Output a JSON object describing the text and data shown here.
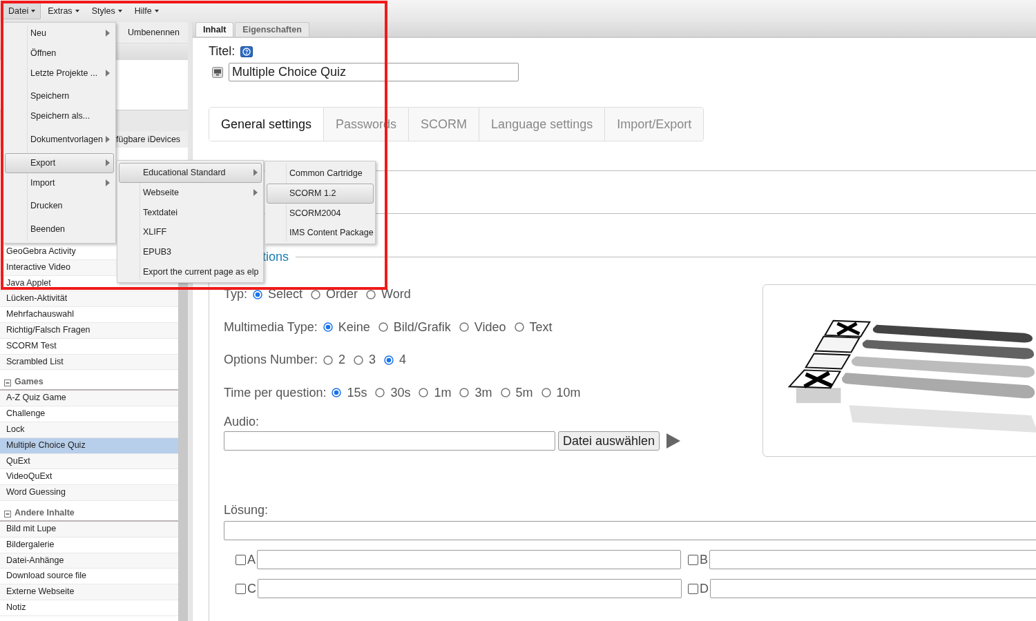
{
  "menubar": [
    {
      "label": "Datei",
      "selected": true
    },
    {
      "label": "Extras",
      "selected": false
    },
    {
      "label": "Styles",
      "selected": false
    },
    {
      "label": "Hilfe",
      "selected": false
    }
  ],
  "file_menu": [
    {
      "kind": "item",
      "label": "Neu",
      "submenu": true,
      "selected": false
    },
    {
      "kind": "item",
      "label": "Öffnen",
      "submenu": false,
      "selected": false
    },
    {
      "kind": "item",
      "label": "Letzte Projekte ...",
      "submenu": true,
      "selected": false
    },
    {
      "kind": "separator"
    },
    {
      "kind": "item",
      "label": "Speichern",
      "submenu": false,
      "selected": false
    },
    {
      "kind": "item",
      "label": "Speichern als...",
      "submenu": false,
      "selected": false
    },
    {
      "kind": "separator"
    },
    {
      "kind": "item",
      "label": "Dokumentvorlagen",
      "submenu": true,
      "selected": false
    },
    {
      "kind": "separator"
    },
    {
      "kind": "item",
      "label": "Export",
      "submenu": true,
      "selected": true
    },
    {
      "kind": "item",
      "label": "Import",
      "submenu": true,
      "selected": false
    },
    {
      "kind": "separator"
    },
    {
      "kind": "item",
      "label": "Drucken",
      "submenu": false,
      "selected": false
    },
    {
      "kind": "separator"
    },
    {
      "kind": "item",
      "label": "Beenden",
      "submenu": false,
      "selected": false
    }
  ],
  "export_menu": [
    {
      "kind": "item",
      "label": "Educational Standard",
      "submenu": true,
      "selected": true
    },
    {
      "kind": "item",
      "label": "Webseite",
      "submenu": true,
      "selected": false
    },
    {
      "kind": "item",
      "label": "Textdatei",
      "submenu": false,
      "selected": false
    },
    {
      "kind": "item",
      "label": "XLIFF",
      "submenu": false,
      "selected": false
    },
    {
      "kind": "item",
      "label": "EPUB3",
      "submenu": false,
      "selected": false
    },
    {
      "kind": "item",
      "label": "Export the current page as elp",
      "submenu": false,
      "selected": false
    }
  ],
  "standard_menu": [
    {
      "kind": "item",
      "label": "Common Cartridge",
      "submenu": false,
      "selected": false
    },
    {
      "kind": "item",
      "label": "SCORM 1.2",
      "submenu": false,
      "selected": true
    },
    {
      "kind": "item",
      "label": "SCORM2004",
      "submenu": false,
      "selected": false
    },
    {
      "kind": "item",
      "label": "IMS Content Package",
      "submenu": false,
      "selected": false
    }
  ],
  "highlight_frame": true,
  "left_panel": {
    "button": "Umbenennen",
    "header": "fügbare iDevices",
    "groups": [
      {
        "items": [
          {
            "label": "GeoGebra Activity",
            "selected": false
          },
          {
            "label": "Interactive Video",
            "selected": false
          },
          {
            "label": "Java Applet",
            "selected": false
          },
          {
            "label": "Lücken-Aktivität",
            "selected": false
          },
          {
            "label": "Mehrfachauswahl",
            "selected": false
          },
          {
            "label": "Richtig/Falsch Fragen",
            "selected": false
          },
          {
            "label": "SCORM Test",
            "selected": false
          },
          {
            "label": "Scrambled List",
            "selected": false
          }
        ]
      },
      {
        "title": "Games",
        "expanded": true,
        "items": [
          {
            "label": "A-Z Quiz Game",
            "selected": false
          },
          {
            "label": "Challenge",
            "selected": false
          },
          {
            "label": "Lock",
            "selected": false
          },
          {
            "label": "Multiple Choice Quiz",
            "selected": true
          },
          {
            "label": "QuExt",
            "selected": false
          },
          {
            "label": "VideoQuExt",
            "selected": false
          },
          {
            "label": "Word Guessing",
            "selected": false
          }
        ]
      },
      {
        "title": "Andere Inhalte",
        "expanded": true,
        "items": [
          {
            "label": "Bild mit Lupe",
            "selected": false
          },
          {
            "label": "Bildergalerie",
            "selected": false
          },
          {
            "label": "Datei-Anhänge",
            "selected": false
          },
          {
            "label": "Download source file",
            "selected": false
          },
          {
            "label": "Externe Webseite",
            "selected": false
          },
          {
            "label": "Notiz",
            "selected": false
          }
        ]
      }
    ]
  },
  "editor": {
    "tabs": [
      {
        "label": "Inhalt",
        "selected": true
      },
      {
        "label": "Eigenschaften",
        "selected": false
      }
    ],
    "title_label": "Titel:",
    "title_value": "Multiple Choice Quiz",
    "settings_tabs": [
      {
        "label": "General settings",
        "selected": true
      },
      {
        "label": "Passwords",
        "selected": false
      },
      {
        "label": "SCORM",
        "selected": false
      },
      {
        "label": "Language settings",
        "selected": false
      },
      {
        "label": "Import/Export",
        "selected": false
      }
    ],
    "section_legend": "tions",
    "option_groups": [
      {
        "label": "Typ:",
        "options": [
          {
            "label": "Select",
            "selected": true
          },
          {
            "label": "Order",
            "selected": false
          },
          {
            "label": "Word",
            "selected": false
          }
        ]
      },
      {
        "label": "Multimedia Type:",
        "options": [
          {
            "label": "Keine",
            "selected": true
          },
          {
            "label": "Bild/Grafik",
            "selected": false
          },
          {
            "label": "Video",
            "selected": false
          },
          {
            "label": "Text",
            "selected": false
          }
        ]
      },
      {
        "label": "Options Number:",
        "options": [
          {
            "label": "2",
            "selected": false
          },
          {
            "label": "3",
            "selected": false
          },
          {
            "label": "4",
            "selected": true
          }
        ]
      },
      {
        "label": "Time per question:",
        "options": [
          {
            "label": "15s",
            "selected": true
          },
          {
            "label": "30s",
            "selected": false
          },
          {
            "label": "1m",
            "selected": false
          },
          {
            "label": "3m",
            "selected": false
          },
          {
            "label": "5m",
            "selected": false
          },
          {
            "label": "10m",
            "selected": false
          }
        ]
      }
    ],
    "audio": {
      "label": "Audio:",
      "button": "Datei auswählen"
    },
    "solution_label": "Lösung:",
    "answers": [
      {
        "letter": "A",
        "checked": false
      },
      {
        "letter": "B",
        "checked": false
      },
      {
        "letter": "C",
        "checked": false
      },
      {
        "letter": "D",
        "checked": false
      }
    ]
  }
}
